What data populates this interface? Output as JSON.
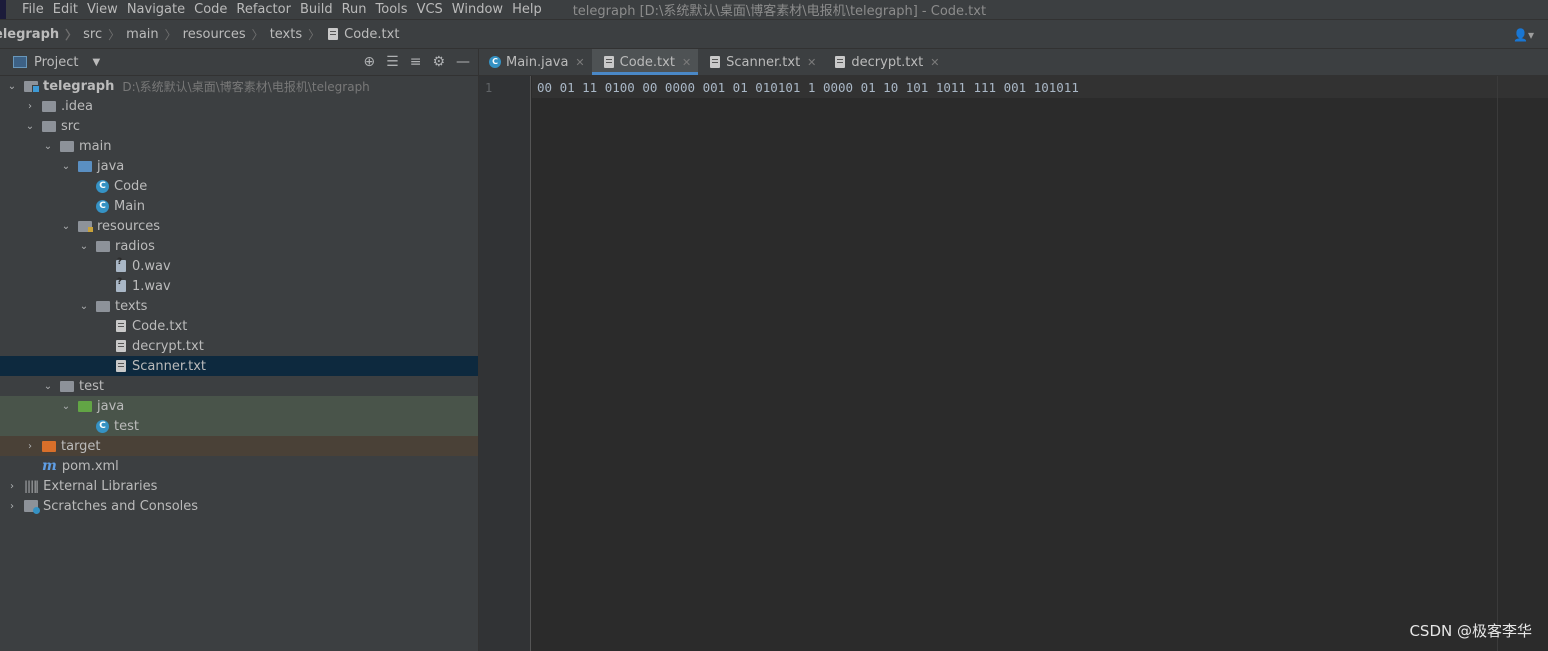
{
  "menubar": {
    "items": [
      "File",
      "Edit",
      "View",
      "Navigate",
      "Code",
      "Refactor",
      "Build",
      "Run",
      "Tools",
      "VCS",
      "Window",
      "Help"
    ],
    "window_title": "telegraph [D:\\系统默认\\桌面\\博客素材\\电报机\\telegraph] - Code.txt"
  },
  "breadcrumb": [
    "elegraph",
    "src",
    "main",
    "resources",
    "texts",
    "Code.txt"
  ],
  "project_panel": {
    "title": "Project"
  },
  "tree": [
    {
      "label": "telegraph",
      "path": "D:\\系统默认\\桌面\\博客素材\\电报机\\telegraph"
    },
    {
      "label": ".idea"
    },
    {
      "label": "src"
    },
    {
      "label": "main"
    },
    {
      "label": "java"
    },
    {
      "label": "Code"
    },
    {
      "label": "Main"
    },
    {
      "label": "resources"
    },
    {
      "label": "radios"
    },
    {
      "label": "0.wav"
    },
    {
      "label": "1.wav"
    },
    {
      "label": "texts"
    },
    {
      "label": "Code.txt"
    },
    {
      "label": "decrypt.txt"
    },
    {
      "label": "Scanner.txt"
    },
    {
      "label": "test"
    },
    {
      "label": "java"
    },
    {
      "label": "test"
    },
    {
      "label": "target"
    },
    {
      "label": "pom.xml"
    },
    {
      "label": "External Libraries"
    },
    {
      "label": "Scratches and Consoles"
    }
  ],
  "tabs": [
    {
      "label": "Main.java"
    },
    {
      "label": "Code.txt"
    },
    {
      "label": "Scanner.txt"
    },
    {
      "label": "decrypt.txt"
    }
  ],
  "editor": {
    "line_number": "1",
    "content": "00 01 11 0100 00 0000 001 01 010101 1 0000 01 10 101 1011 111 001 101011"
  },
  "watermark": "CSDN @极客李华",
  "colors": {
    "selection": "#0d293e",
    "accent": "#4a88c7",
    "test_folder": "#62a545",
    "excluded_folder": "#d96f2a"
  }
}
